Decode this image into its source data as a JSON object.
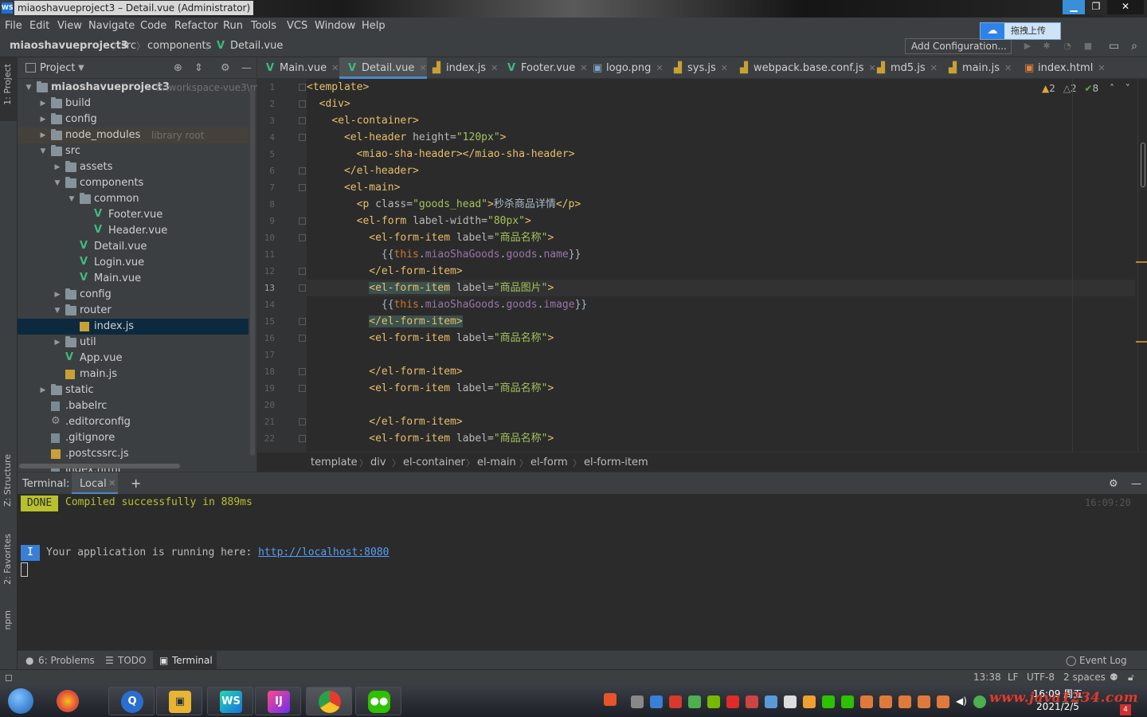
{
  "window": {
    "title": "miaoshavueproject3 – Detail.vue (Administrator)",
    "app_icon": "WS"
  },
  "menu": [
    "File",
    "Edit",
    "View",
    "Navigate",
    "Code",
    "Refactor",
    "Run",
    "Tools",
    "VCS",
    "Window",
    "Help"
  ],
  "navbar": {
    "crumbs": [
      "miaoshavueproject3",
      "src",
      "components",
      "Detail.vue"
    ],
    "add_config": "Add Configuration...",
    "upload_tip": "拖拽上传"
  },
  "side_tabs": {
    "project": "1: Project",
    "structure": "Z: Structure",
    "favorites": "2: Favorites",
    "npm": "npm"
  },
  "project": {
    "title": "Project",
    "root_path": "E:\\workspace-vue3\\m",
    "library_hint": "library root",
    "tree": [
      {
        "label": "miaoshavueproject3",
        "type": "folder",
        "depth": 0,
        "expanded": true
      },
      {
        "label": "build",
        "type": "folder",
        "depth": 1
      },
      {
        "label": "config",
        "type": "folder",
        "depth": 1
      },
      {
        "label": "node_modules",
        "type": "folder",
        "depth": 1
      },
      {
        "label": "src",
        "type": "folder",
        "depth": 1,
        "expanded": true
      },
      {
        "label": "assets",
        "type": "folder",
        "depth": 2
      },
      {
        "label": "components",
        "type": "folder",
        "depth": 2,
        "expanded": true
      },
      {
        "label": "common",
        "type": "folder",
        "depth": 3,
        "expanded": true
      },
      {
        "label": "Footer.vue",
        "type": "vue",
        "depth": 4
      },
      {
        "label": "Header.vue",
        "type": "vue",
        "depth": 4
      },
      {
        "label": "Detail.vue",
        "type": "vue",
        "depth": 3
      },
      {
        "label": "Login.vue",
        "type": "vue",
        "depth": 3
      },
      {
        "label": "Main.vue",
        "type": "vue",
        "depth": 3
      },
      {
        "label": "config",
        "type": "folder",
        "depth": 2
      },
      {
        "label": "router",
        "type": "folder",
        "depth": 2,
        "expanded": true
      },
      {
        "label": "index.js",
        "type": "js",
        "depth": 3,
        "selected": true
      },
      {
        "label": "util",
        "type": "folder",
        "depth": 2
      },
      {
        "label": "App.vue",
        "type": "vue",
        "depth": 2
      },
      {
        "label": "main.js",
        "type": "js",
        "depth": 2
      },
      {
        "label": "static",
        "type": "folder",
        "depth": 1
      },
      {
        "label": ".babelrc",
        "type": "cfg",
        "depth": 1
      },
      {
        "label": ".editorconfig",
        "type": "gear",
        "depth": 1
      },
      {
        "label": ".gitignore",
        "type": "cfg",
        "depth": 1
      },
      {
        "label": ".postcssrc.js",
        "type": "js",
        "depth": 1
      },
      {
        "label": "index.html",
        "type": "cfg",
        "depth": 1
      }
    ]
  },
  "tabs": [
    {
      "label": "Main.vue",
      "icon": "vue"
    },
    {
      "label": "Detail.vue",
      "icon": "vue",
      "active": true
    },
    {
      "label": "index.js",
      "icon": "js"
    },
    {
      "label": "Footer.vue",
      "icon": "vue"
    },
    {
      "label": "logo.png",
      "icon": "img"
    },
    {
      "label": "sys.js",
      "icon": "js"
    },
    {
      "label": "webpack.base.conf.js",
      "icon": "js"
    },
    {
      "label": "md5.js",
      "icon": "js"
    },
    {
      "label": "main.js",
      "icon": "js"
    },
    {
      "label": "index.html",
      "icon": "html"
    }
  ],
  "inspections": {
    "warn1": "2",
    "warn2": "2",
    "ok": "8"
  },
  "code": {
    "current_line": 13,
    "lines": [
      {
        "n": "1",
        "html": "<span class=\"tag\">&lt;template&gt;</span>"
      },
      {
        "n": "2",
        "html": "  <span class=\"tag\">&lt;div&gt;</span>"
      },
      {
        "n": "3",
        "html": "    <span class=\"tag\">&lt;el-container&gt;</span>"
      },
      {
        "n": "4",
        "html": "      <span class=\"tag\">&lt;el-header </span><span class=\"attr\">height=</span><span class=\"str\">\"120px\"</span><span class=\"tag\">&gt;</span>"
      },
      {
        "n": "5",
        "html": "        <span class=\"tag\">&lt;miao-sha-header&gt;&lt;/miao-sha-header&gt;</span>"
      },
      {
        "n": "6",
        "html": "      <span class=\"tag\">&lt;/el-header&gt;</span>"
      },
      {
        "n": "7",
        "html": "      <span class=\"tag\">&lt;el-main&gt;</span>"
      },
      {
        "n": "8",
        "html": "        <span class=\"tag\">&lt;p </span><span class=\"attr\">class=</span><span class=\"str\">\"goods_head\"</span><span class=\"tag\">&gt;</span>秒杀商品详情<span class=\"tag\">&lt;/p&gt;</span>"
      },
      {
        "n": "9",
        "html": "        <span class=\"tag\">&lt;el-form </span><span class=\"attr\">label-width=</span><span class=\"str\">\"80px\"</span><span class=\"tag\">&gt;</span>"
      },
      {
        "n": "10",
        "html": "          <span class=\"tag\">&lt;el-form-item </span><span class=\"attr\">label=</span><span class=\"str\">\"商品名称\"</span><span class=\"tag\">&gt;</span>"
      },
      {
        "n": "11",
        "html": "            {{<span class=\"kw\">this</span>.<span class=\"fld\">miaoShaGoods</span>.<span class=\"fld\">goods</span>.<span class=\"fld\">name</span>}}"
      },
      {
        "n": "12",
        "html": "          <span class=\"tag\">&lt;/el-form-item&gt;</span>"
      },
      {
        "n": "13",
        "html": "          <span class=\"tag hl\">&lt;el-form-item</span><span class=\"tag\"> </span><span class=\"attr\">label=</span><span class=\"str\">\"商品图片\"</span><span class=\"tag\">&gt;</span>"
      },
      {
        "n": "14",
        "html": "            {{<span class=\"kw\">this</span>.<span class=\"fld\">miaoShaGoods</span>.<span class=\"fld\">goods</span>.<span class=\"fld\">image</span>}}"
      },
      {
        "n": "15",
        "html": "          <span class=\"tag hl\">&lt;/el-form-item&gt;</span>"
      },
      {
        "n": "16",
        "html": "          <span class=\"tag\">&lt;el-form-item </span><span class=\"attr\">label=</span><span class=\"str\">\"商品名称\"</span><span class=\"tag\">&gt;</span>"
      },
      {
        "n": "17",
        "html": ""
      },
      {
        "n": "18",
        "html": "          <span class=\"tag\">&lt;/el-form-item&gt;</span>"
      },
      {
        "n": "19",
        "html": "          <span class=\"tag\">&lt;el-form-item </span><span class=\"attr\">label=</span><span class=\"str\">\"商品名称\"</span><span class=\"tag\">&gt;</span>"
      },
      {
        "n": "20",
        "html": ""
      },
      {
        "n": "21",
        "html": "          <span class=\"tag\">&lt;/el-form-item&gt;</span>"
      },
      {
        "n": "22",
        "html": "          <span class=\"tag\">&lt;el-form-item </span><span class=\"attr\">label=</span><span class=\"str\">\"商品名称\"</span><span class=\"tag\">&gt;</span>"
      }
    ]
  },
  "breadcrumb": [
    "template",
    "div",
    "el-container",
    "el-main",
    "el-form",
    "el-form-item"
  ],
  "terminal": {
    "label": "Terminal:",
    "tab": "Local",
    "done_badge": "DONE",
    "done_text": "Compiled successfully in 889ms",
    "time": "16:09:20",
    "info_badge": "I",
    "run_text": "Your application is running here: ",
    "run_link": "http://localhost:8080"
  },
  "tool_tabs": {
    "problems": "6: Problems",
    "todo": "TODO",
    "terminal": "Terminal",
    "event_log": "Event Log"
  },
  "status": {
    "position": "13:38",
    "line_sep": "LF",
    "encoding": "UTF-8",
    "indent": "2 spaces"
  },
  "taskbar": {
    "clock_time": "16:09 周五",
    "clock_date": "2021/2/5",
    "watermark": "www.java1234.com",
    "notify_count": "4"
  }
}
